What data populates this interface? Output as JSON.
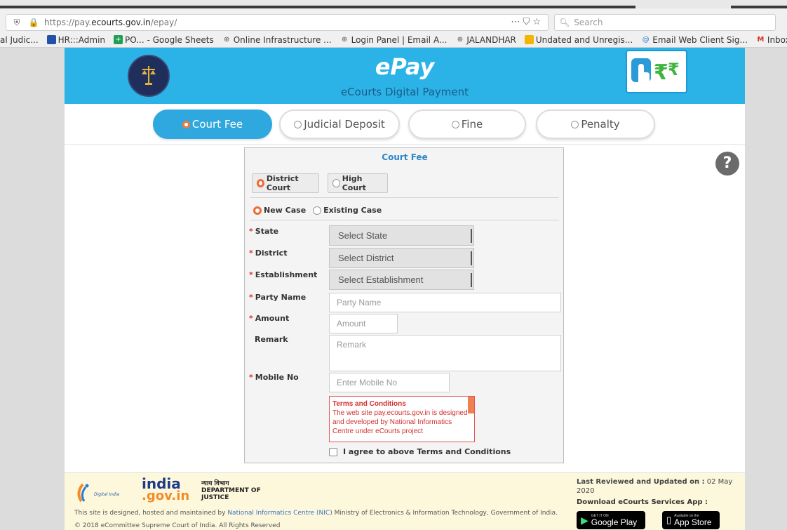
{
  "browser": {
    "url_prefix": "https://pay.",
    "url_domain": "ecourts.gov.in",
    "url_suffix": "/epay/",
    "actions": "⋯  ⛉  ☆",
    "search_placeholder": "Search",
    "bookmarks": [
      {
        "label": "al Judic...",
        "icon": "none"
      },
      {
        "label": "HR:::Admin",
        "icon": "blue-square"
      },
      {
        "label": "PO... - Google Sheets",
        "icon": "sheets-icon"
      },
      {
        "label": "Online Infrastructure ...",
        "icon": "globe-icon"
      },
      {
        "label": "Login Panel | Email A...",
        "icon": "globe-icon"
      },
      {
        "label": "JALANDHAR",
        "icon": "globe-icon"
      },
      {
        "label": "Undated and Unregis...",
        "icon": "drive-icon"
      },
      {
        "label": "Email Web Client Sig...",
        "icon": "mail-icon"
      },
      {
        "label": "Inbox - d",
        "icon": "gmail-icon"
      }
    ]
  },
  "header": {
    "title": "ePay",
    "subtitle": "eCourts Digital Payment"
  },
  "tabs": [
    {
      "label": "Court Fee",
      "active": true
    },
    {
      "label": "Judicial Deposit",
      "active": false
    },
    {
      "label": "Fine",
      "active": false
    },
    {
      "label": "Penalty",
      "active": false
    }
  ],
  "help": "?",
  "form": {
    "title": "Court Fee",
    "court_options": [
      "District Court",
      "High Court"
    ],
    "case_options": [
      "New Case",
      "Existing Case"
    ],
    "state_label": "State",
    "state_value": "Select State",
    "district_label": "District",
    "district_value": "Select District",
    "establishment_label": "Establishment",
    "establishment_value": "Select Establishment",
    "party_label": "Party Name",
    "party_placeholder": "Party Name",
    "amount_label": "Amount",
    "amount_placeholder": "Amount",
    "remark_label": "Remark",
    "remark_placeholder": "Remark",
    "mobile_label": "Mobile No",
    "mobile_placeholder": "Enter Mobile No",
    "terms_heading": "Terms and Conditions",
    "terms_text": "The web site pay.ecourts.gov.in is designed and developed by National Informatics Centre under eCourts project",
    "agree_label": "I agree to above Terms and Conditions"
  },
  "footer": {
    "digital_india": "Digital India",
    "india": "india",
    "govin": ".gov.in",
    "doj_hindi": "न्याय विभाग",
    "doj1": "DEPARTMENT OF",
    "doj2": "JUSTICE",
    "line1_pre": "This site is designed, hosted and maintained by ",
    "line1_nic": "National Informatics Centre (NIC)",
    "line1_post": " Ministry of Electronics & Information Technology, Government of India.",
    "line2": "© 2018 eCommittee Supreme Court of India. All Rights Reserved",
    "review_label": "Last Reviewed and Updated on :",
    "review_date": "02 May 2020",
    "download": "Download eCourts Services App :",
    "gp_small": "GET IT ON",
    "gp_big": "Google Play",
    "as_small": "Available on the",
    "as_big": "App Store"
  },
  "colors": {
    "header_blue": "#2bb3e8",
    "active_tab": "#2fa7df",
    "radio_orange": "#ef6b33",
    "terms_red": "#d12f2f"
  }
}
